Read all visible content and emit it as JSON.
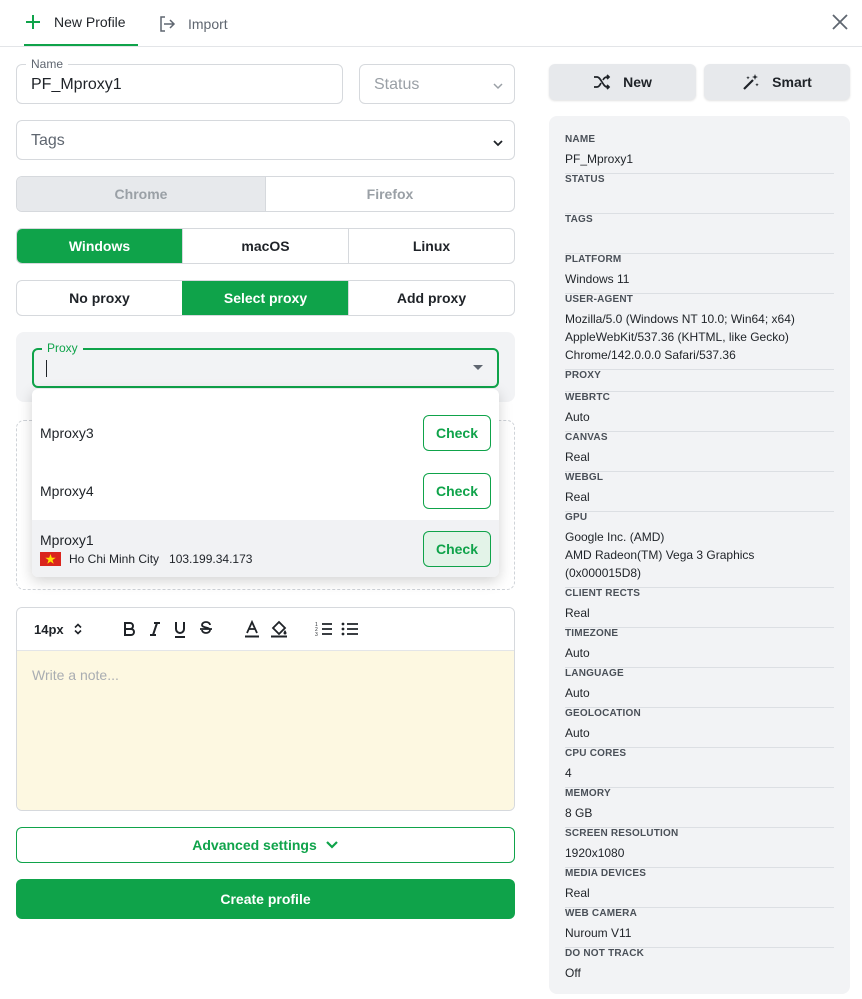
{
  "tabs": {
    "new_profile": "New Profile",
    "import": "Import"
  },
  "form": {
    "name_label": "Name",
    "name_value": "PF_Mproxy1",
    "status_placeholder": "Status",
    "tags_placeholder": "Tags",
    "browsers": [
      "Chrome",
      "Firefox"
    ],
    "os_options": [
      "Windows",
      "macOS",
      "Linux"
    ],
    "proxy_modes": [
      "No proxy",
      "Select proxy",
      "Add proxy"
    ],
    "proxy_label": "Proxy",
    "proxy_options": [
      {
        "name": "Mproxy3",
        "check": "Check"
      },
      {
        "name": "Mproxy4",
        "check": "Check"
      },
      {
        "name": "Mproxy1",
        "city": "Ho Chi Minh City",
        "ip": "103.199.34.173",
        "check": "Check"
      }
    ],
    "font_size": "14px",
    "note_placeholder": "Write a note...",
    "advanced_settings": "Advanced settings",
    "create_profile": "Create profile"
  },
  "actions": {
    "new": "New",
    "smart": "Smart"
  },
  "summary": [
    {
      "key": "NAME",
      "value": "PF_Mproxy1"
    },
    {
      "key": "STATUS",
      "value": ""
    },
    {
      "key": "TAGS",
      "value": ""
    },
    {
      "key": "PLATFORM",
      "value": "Windows 11"
    },
    {
      "key": "USER-AGENT",
      "value": "Mozilla/5.0 (Windows NT 10.0; Win64; x64)\nAppleWebKit/537.36 (KHTML, like Gecko)\nChrome/142.0.0.0 Safari/537.36"
    },
    {
      "key": "PROXY",
      "value": ""
    },
    {
      "key": "WEBRTC",
      "value": "Auto"
    },
    {
      "key": "CANVAS",
      "value": "Real"
    },
    {
      "key": "WEBGL",
      "value": "Real"
    },
    {
      "key": "GPU",
      "value": "Google Inc. (AMD)\nAMD Radeon(TM) Vega 3 Graphics\n(0x000015D8)"
    },
    {
      "key": "CLIENT RECTS",
      "value": "Real"
    },
    {
      "key": "TIMEZONE",
      "value": "Auto"
    },
    {
      "key": "LANGUAGE",
      "value": "Auto"
    },
    {
      "key": "GEOLOCATION",
      "value": "Auto"
    },
    {
      "key": "CPU CORES",
      "value": "4"
    },
    {
      "key": "MEMORY",
      "value": "8 GB"
    },
    {
      "key": "SCREEN RESOLUTION",
      "value": "1920x1080"
    },
    {
      "key": "MEDIA DEVICES",
      "value": "Real"
    },
    {
      "key": "WEB CAMERA",
      "value": "Nuroum V11"
    },
    {
      "key": "DO NOT TRACK",
      "value": "Off"
    }
  ],
  "colors": {
    "accent": "#0fa34a",
    "note_bg": "#fdf8e1",
    "panel_bg": "#f2f3f5"
  }
}
